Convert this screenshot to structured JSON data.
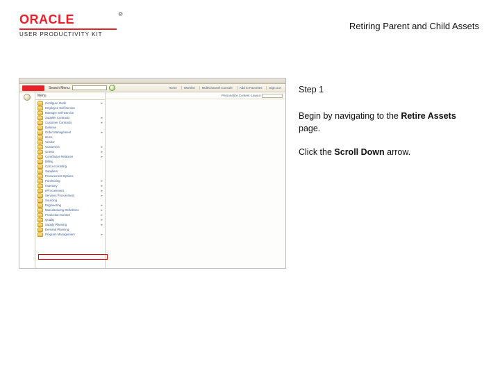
{
  "header": {
    "brand": "ORACLE",
    "subbrand": "USER PRODUCTIVITY KIT"
  },
  "doc_title": "Retiring Parent and Child Assets",
  "screenshot": {
    "search_label": "Search Menu:",
    "personalize_label": "Personalize Content",
    "layout_label": "Layout",
    "sign_out": "Sign out",
    "top_tabs": [
      "Home",
      "Worklist",
      "MultiChannel Console",
      "Add to Favorites"
    ],
    "menu_title": "Menu",
    "menu_items": [
      {
        "label": "Configure Outlk",
        "expand": true
      },
      {
        "label": "Employee Self-Service",
        "expand": false
      },
      {
        "label": "Manager Self-Service",
        "expand": false
      },
      {
        "label": "Supplier Contracts",
        "expand": true
      },
      {
        "label": "Customer Contracts",
        "expand": true
      },
      {
        "label": "Defense",
        "expand": false
      },
      {
        "label": "Order Management",
        "expand": true
      },
      {
        "label": "Items",
        "expand": false
      },
      {
        "label": "Vendor",
        "expand": false
      },
      {
        "label": "Customers",
        "expand": true
      },
      {
        "label": "Grants",
        "expand": true
      },
      {
        "label": "Contributor Relations",
        "expand": true
      },
      {
        "label": "Billing",
        "expand": false
      },
      {
        "label": "Cost Accounting",
        "expand": false
      },
      {
        "label": "Suppliers",
        "expand": false
      },
      {
        "label": "Procurement Options",
        "expand": false
      },
      {
        "label": "Purchasing",
        "expand": true
      },
      {
        "label": "Inventory",
        "expand": true
      },
      {
        "label": "eProcurement",
        "expand": true
      },
      {
        "label": "Services Procurement",
        "expand": true
      },
      {
        "label": "Sourcing",
        "expand": false
      },
      {
        "label": "Engineering",
        "expand": true
      },
      {
        "label": "Manufacturing Definitions",
        "expand": true
      },
      {
        "label": "Production Control",
        "expand": true
      },
      {
        "label": "Quality",
        "expand": true
      },
      {
        "label": "Supply Planning",
        "expand": true
      },
      {
        "label": "Demand Planning",
        "expand": false
      },
      {
        "label": "Program Management",
        "expand": true
      }
    ]
  },
  "instructions": {
    "step_label": "Step 1",
    "line1_pre": "Begin by navigating to the ",
    "line1_bold": "Retire Assets",
    "line1_post": " page.",
    "line2_pre": "Click the ",
    "line2_bold": "Scroll Down",
    "line2_post": " arrow."
  }
}
